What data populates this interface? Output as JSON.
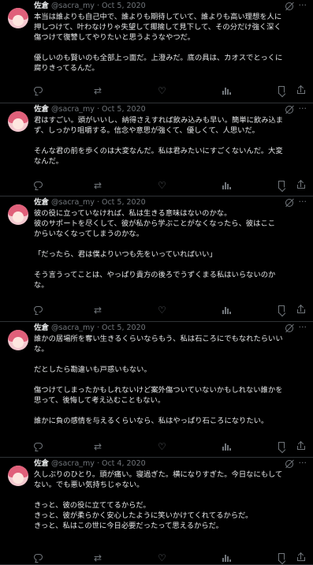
{
  "tweets": [
    {
      "name": "佐倉",
      "handle": "@sacra_my",
      "date": "Oct 5, 2020",
      "paragraphs": [
        "本当は誰よりも自己中で、誰よりも期待していて、誰よりも高い理想を人に\n押しつけて、叶わなけりゃ失望して揶揄して見下して、その分だけ強く深く\n傷つけて復讐してやりたいと思うようなやつだ。",
        "優しいのも賢いのも全部上っ面だ。上澄みだ。底の具は、カオスでとっくに\n腐りきってるんだ。"
      ]
    },
    {
      "name": "佐倉",
      "handle": "@sacra_my",
      "date": "Oct 5, 2020",
      "paragraphs": [
        "君はすごい。頭がいいし、納得さえすれば飲み込みも早い。簡単に飲み込ま\nず、しっかり咀嚼する。信念や意思が強くて、優しくて、人思いだ。",
        "そんな君の前を歩くのは大変なんだ。私は君みたいにすごくないんだ。大変\nなんだ。"
      ]
    },
    {
      "name": "佐倉",
      "handle": "@sacra_my",
      "date": "Oct 5, 2020",
      "paragraphs": [
        "彼の役に立っていなければ、私は生きる意味はないのかな。\n彼のサポートを尽くして、彼が私から学ぶことがなくなったら、彼はここ\nからいなくなってしまうのかな。",
        "「だったら、君は僕よりいつも先をいっていればいい」",
        "そう言うってことは、やっぱり貴方の後ろでうずくまる私はいらないのか\nな。"
      ]
    },
    {
      "name": "佐倉",
      "handle": "@sacra_my",
      "date": "Oct 5, 2020",
      "paragraphs": [
        "誰かの居場所を奪い生きるくらいならもう、私は石ころにでもなれたらいい\nな。",
        "だとしたら勘違いも戸惑いもない。",
        "傷つけてしまったかもしれないけど案外傷ついていないかもしれない誰かを\n思って、後悔して考え込むこともない。",
        "誰かに負の感情を与えるくらいなら、私はやっぱり石ころになりたい。"
      ]
    },
    {
      "name": "佐倉",
      "handle": "@sacra_my",
      "date": "Oct 4, 2020",
      "paragraphs": [
        "久しぶりのひとり。頭が痛い。寝過ぎた。横になりすぎた。今日なにもして\nない。でも悪い気持ちじゃない。",
        "きっと、彼の役に立ててるからだ。\nきっと、彼が柔らかく安心したように笑いかけてくれてるからだ。\nきっと、私はこの世に今日必要だったって思えるからだ。"
      ]
    }
  ],
  "icons": {
    "more": "more-horizontal-icon",
    "grok": "grok-icon",
    "reply": "reply-icon",
    "retweet": "retweet-icon",
    "like": "like-icon",
    "views": "views-icon",
    "bookmark": "bookmark-icon",
    "share": "share-icon"
  },
  "colors": {
    "background": "#000000",
    "text": "#e7e9ea",
    "muted": "#71767b",
    "divider": "#2f3336",
    "avatar": "#e0607a"
  }
}
